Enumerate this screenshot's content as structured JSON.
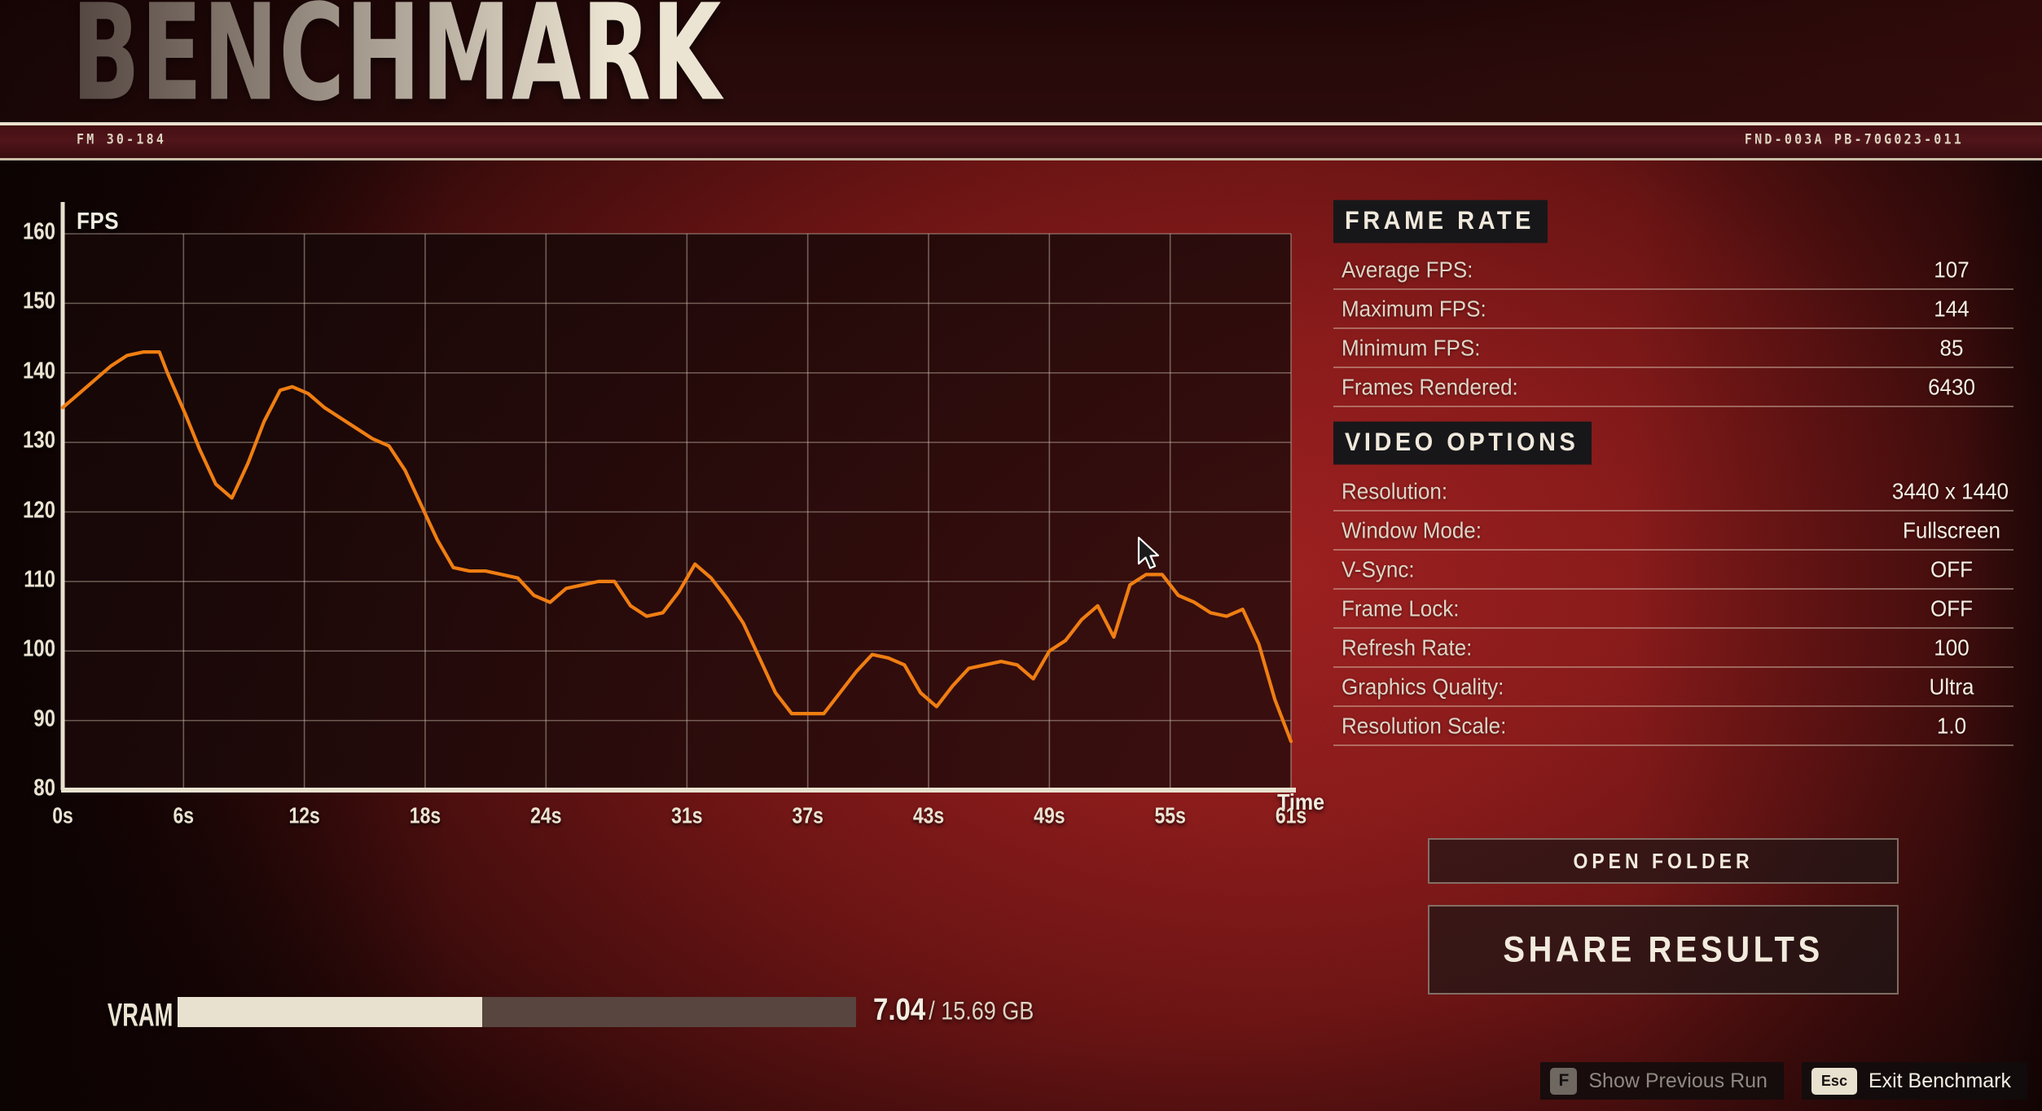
{
  "header": {
    "title": "BENCHMARK",
    "code_left": "FM 30-184",
    "code_right": "FND-003A PB-70G023-011"
  },
  "chart": {
    "y_axis_label": "FPS",
    "x_axis_label": "Time"
  },
  "chart_data": {
    "type": "line",
    "title": "",
    "xlabel": "Time",
    "ylabel": "FPS",
    "xlim": [
      0,
      61
    ],
    "ylim": [
      80,
      160
    ],
    "yticks": [
      80,
      90,
      100,
      110,
      120,
      130,
      140,
      150,
      160
    ],
    "xticks": [
      0,
      6,
      12,
      18,
      24,
      31,
      37,
      43,
      49,
      55,
      61
    ],
    "xtick_labels": [
      "0s",
      "6s",
      "12s",
      "18s",
      "24s",
      "31s",
      "37s",
      "43s",
      "49s",
      "55s",
      "61s"
    ],
    "grid": true,
    "legend": "none",
    "line_color": "#ef7e12",
    "series": [
      {
        "name": "FPS",
        "x": [
          0,
          0.8,
          1.6,
          2.4,
          3.2,
          4.0,
          4.8,
          5.2,
          6.1,
          6.8,
          7.6,
          8.4,
          9.2,
          10.0,
          10.8,
          11.4,
          12.2,
          13.0,
          13.8,
          14.6,
          15.4,
          16.2,
          17.0,
          17.8,
          18.6,
          19.4,
          20.2,
          21.0,
          21.8,
          22.6,
          23.4,
          24.2,
          25.0,
          25.8,
          26.6,
          27.4,
          28.2,
          29.0,
          29.8,
          30.6,
          31.4,
          32.2,
          33.0,
          33.8,
          34.6,
          35.4,
          36.2,
          37.0,
          37.8,
          38.6,
          39.4,
          40.2,
          41.0,
          41.8,
          42.6,
          43.4,
          44.2,
          45.0,
          45.8,
          46.6,
          47.4,
          48.2,
          49.0,
          49.8,
          50.6,
          51.4,
          52.2,
          53.0,
          53.8,
          54.6,
          55.4,
          56.2,
          57.0,
          57.8,
          58.6,
          59.4,
          60.2,
          61.0
        ],
        "values": [
          135,
          137,
          139,
          141,
          142.5,
          143,
          143,
          140,
          134,
          129,
          124,
          122,
          127,
          133,
          137.5,
          138,
          137,
          135,
          133.5,
          132,
          130.5,
          129.5,
          126,
          121,
          116,
          112,
          111.5,
          111.5,
          111,
          110.5,
          108,
          107,
          109,
          109.5,
          110,
          110,
          106.5,
          105,
          105.5,
          108.5,
          112.5,
          110.5,
          107.5,
          104,
          99,
          94,
          91,
          91,
          91,
          94,
          97,
          99.5,
          99,
          98,
          94,
          92,
          95,
          97.5,
          98,
          98.5,
          98,
          96,
          100,
          101.5,
          104.5,
          106.5,
          102,
          109.5,
          111,
          111,
          108,
          107,
          105.5,
          105,
          106,
          101,
          93,
          87
        ]
      }
    ]
  },
  "frame_rate": {
    "heading": "FRAME RATE",
    "rows": [
      {
        "label": "Average FPS:",
        "value": "107"
      },
      {
        "label": "Maximum FPS:",
        "value": "144"
      },
      {
        "label": "Minimum FPS:",
        "value": "85"
      },
      {
        "label": "Frames Rendered:",
        "value": "6430"
      }
    ]
  },
  "video_options": {
    "heading": "VIDEO OPTIONS",
    "rows": [
      {
        "label": "Resolution:",
        "value": "3440 x 1440"
      },
      {
        "label": "Window Mode:",
        "value": "Fullscreen"
      },
      {
        "label": "V-Sync:",
        "value": "OFF"
      },
      {
        "label": "Frame Lock:",
        "value": "OFF"
      },
      {
        "label": "Refresh Rate:",
        "value": "100"
      },
      {
        "label": "Graphics Quality:",
        "value": "Ultra"
      },
      {
        "label": "Resolution Scale:",
        "value": "1.0"
      }
    ]
  },
  "actions": {
    "open_folder": "OPEN FOLDER",
    "share_results": "SHARE RESULTS"
  },
  "vram": {
    "label": "VRAM",
    "used": "7.04",
    "total": "/ 15.69 GB",
    "percent": 44.9
  },
  "hints": [
    {
      "key": "F",
      "text": "Show Previous Run"
    },
    {
      "key": "Esc",
      "text": "Exit Benchmark"
    }
  ]
}
